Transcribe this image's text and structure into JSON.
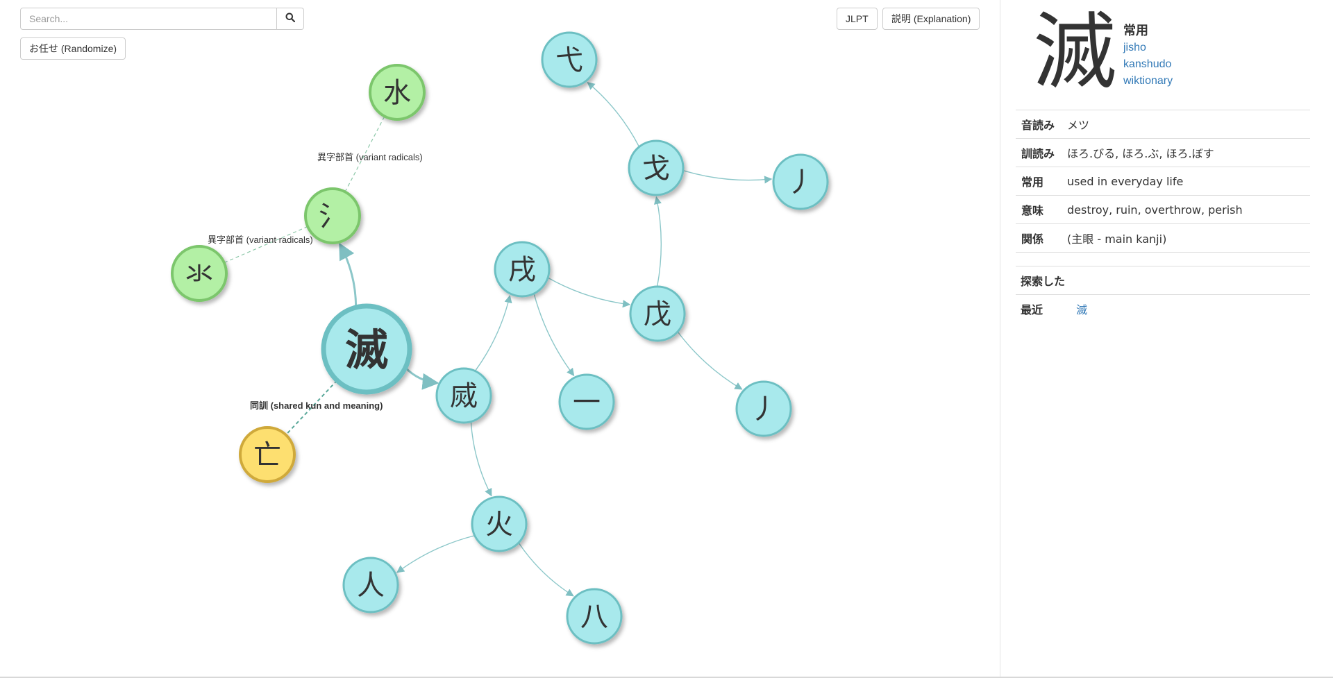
{
  "toolbar": {
    "search_placeholder": "Search...",
    "randomize_label": "お任せ (Randomize)",
    "jlpt_label": "JLPT",
    "explain_label": "説明 (Explanation)"
  },
  "colors": {
    "component": "#a8e9ec",
    "component_border": "#6cbfc2",
    "variant_radical": "#b3f0a5",
    "variant_border": "#7cc66c",
    "related": "#fddf6f",
    "related_border": "#cfa93a",
    "link": "#337ab7"
  },
  "graph": {
    "nodes": [
      {
        "id": "main",
        "char": "滅",
        "type": "main"
      },
      {
        "id": "sanzui",
        "char": "氵",
        "type": "variant"
      },
      {
        "id": "mizu",
        "char": "水",
        "type": "variant"
      },
      {
        "id": "shitamizu",
        "char": "氺",
        "type": "variant"
      },
      {
        "id": "bou",
        "char": "亡",
        "type": "related"
      },
      {
        "id": "metsu_r",
        "char": "烕",
        "type": "component"
      },
      {
        "id": "jutsu",
        "char": "戌",
        "type": "component"
      },
      {
        "id": "ichi",
        "char": "一",
        "type": "component"
      },
      {
        "id": "hi",
        "char": "火",
        "type": "component"
      },
      {
        "id": "hito",
        "char": "人",
        "type": "component"
      },
      {
        "id": "hachi",
        "char": "八",
        "type": "component"
      },
      {
        "id": "bo",
        "char": "戊",
        "type": "component"
      },
      {
        "id": "hokoru",
        "char": "戈",
        "type": "component"
      },
      {
        "id": "yoku",
        "char": "弋",
        "type": "component"
      },
      {
        "id": "no1",
        "char": "丿",
        "type": "component"
      },
      {
        "id": "no2",
        "char": "丿",
        "type": "component"
      }
    ],
    "edges": [
      {
        "from": "main",
        "to": "sanzui",
        "kind": "component"
      },
      {
        "from": "main",
        "to": "metsu_r",
        "kind": "component"
      },
      {
        "from": "metsu_r",
        "to": "jutsu",
        "kind": "component"
      },
      {
        "from": "metsu_r",
        "to": "hi",
        "kind": "component"
      },
      {
        "from": "jutsu",
        "to": "ichi",
        "kind": "component"
      },
      {
        "from": "jutsu",
        "to": "bo",
        "kind": "component"
      },
      {
        "from": "bo",
        "to": "hokoru",
        "kind": "component"
      },
      {
        "from": "bo",
        "to": "no2",
        "kind": "component"
      },
      {
        "from": "hokoru",
        "to": "yoku",
        "kind": "component"
      },
      {
        "from": "hokoru",
        "to": "no1",
        "kind": "component"
      },
      {
        "from": "hi",
        "to": "hito",
        "kind": "component"
      },
      {
        "from": "hi",
        "to": "hachi",
        "kind": "component"
      },
      {
        "from": "sanzui",
        "to": "mizu",
        "kind": "variant"
      },
      {
        "from": "sanzui",
        "to": "shitamizu",
        "kind": "variant"
      },
      {
        "from": "main",
        "to": "bou",
        "kind": "related"
      }
    ],
    "edge_labels": {
      "variant_upper": "異字部首 (variant radicals)",
      "variant_lower": "異字部首 (variant radicals)",
      "related": "同訓 (shared kun and meaning)"
    }
  },
  "panel": {
    "kanji": "滅",
    "grade": "常用",
    "links": [
      "jisho",
      "kanshudo",
      "wiktionary"
    ],
    "rows": [
      {
        "key": "音読み",
        "value": "メツ"
      },
      {
        "key": "訓読み",
        "value": "ほろ.びる, ほろ.ぶ, ほろ.ぼす"
      },
      {
        "key": "常用",
        "value": "used in everyday life"
      },
      {
        "key": "意味",
        "value": "destroy, ruin, overthrow, perish"
      },
      {
        "key": "関係",
        "value": "(主眼 - main kanji)"
      }
    ],
    "explored_label": "探索した",
    "recent_label": "最近",
    "recent_items": [
      "滅"
    ]
  }
}
